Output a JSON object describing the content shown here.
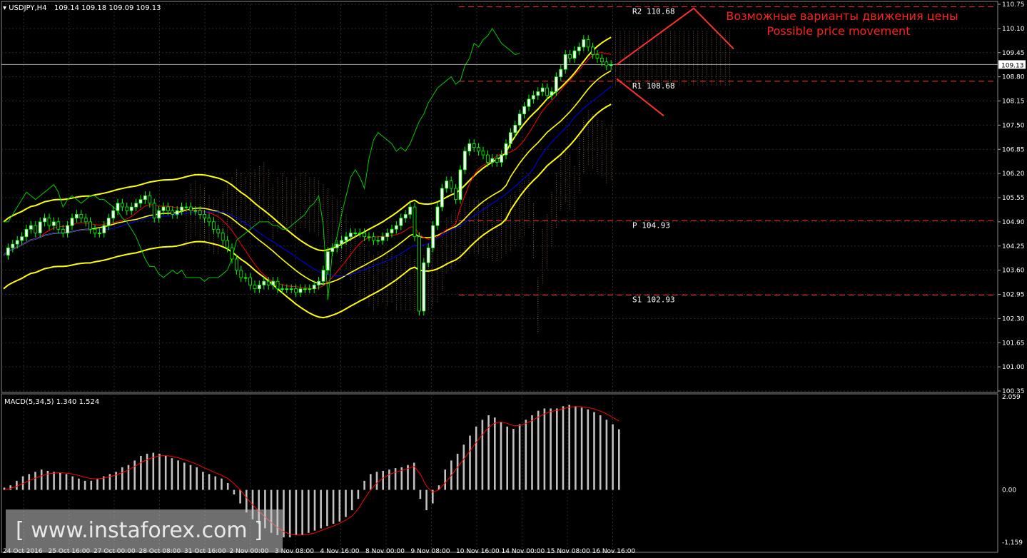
{
  "header": {
    "symbol": "USDJPY,H4",
    "ohlc": "109.14 109.18 109.09 109.13",
    "macd": "MACD(5,34,5) 1.340 1.524"
  },
  "annotation": {
    "line1": "Возможные варианты движения цены",
    "line2": "Possible price movement"
  },
  "watermark": "[ www.instaforex.com ]",
  "colors": {
    "candle_up": "#ffffff",
    "candle_down": "#000000",
    "wick": "#00ff00",
    "bollinger": "#ffff00",
    "ma_red": "#ff0000",
    "ma_blue": "#0000ff",
    "chikou": "#00cc00",
    "cloud": "#e0a080",
    "levels": "#ff3030",
    "macd_bars": "#c0c0c0",
    "macd_signal": "#ff0000",
    "grid": "#2a2a2a"
  },
  "chart_data": [
    {
      "type": "candlestick",
      "ylim": [
        100.35,
        110.75
      ],
      "y_ticks": [
        "110.75",
        "110.10",
        "109.45",
        "108.80",
        "108.15",
        "107.50",
        "106.85",
        "106.20",
        "105.55",
        "104.90",
        "104.25",
        "103.60",
        "102.95",
        "102.30",
        "101.65",
        "101.00",
        "100.35"
      ],
      "current_price": "109.13",
      "x_labels": [
        "24 Oct 2016",
        "25 Oct 16:00",
        "27 Oct 00:00",
        "28 Oct 08:00",
        "31 Oct 16:00",
        "2 Nov 00:00",
        "3 Nov 08:00",
        "4 Nov 16:00",
        "8 Nov 00:00",
        "9 Nov 08:00",
        "10 Nov 16:00",
        "14 Nov 00:00",
        "15 Nov 08:00",
        "16 Nov 16:00"
      ],
      "levels": [
        {
          "name": "R2",
          "label": "R2 110.68",
          "value": 110.68
        },
        {
          "name": "R1",
          "label": "R1 108.68",
          "value": 108.68
        },
        {
          "name": "P",
          "label": "P 104.93",
          "value": 104.93
        },
        {
          "name": "S1",
          "label": "S1 102.93",
          "value": 102.93
        }
      ],
      "close": [
        104.0,
        104.2,
        104.3,
        104.4,
        104.5,
        104.7,
        104.8,
        104.6,
        104.9,
        105.0,
        104.8,
        104.9,
        104.7,
        104.6,
        104.8,
        105.0,
        105.1,
        105.0,
        104.9,
        104.7,
        104.6,
        104.6,
        104.8,
        105.0,
        105.2,
        105.4,
        105.3,
        105.2,
        105.3,
        105.4,
        105.5,
        105.6,
        105.4,
        105.0,
        105.2,
        105.3,
        105.2,
        105.1,
        105.2,
        105.3,
        105.3,
        105.2,
        105.2,
        105.1,
        105.0,
        104.9,
        104.7,
        104.6,
        104.4,
        104.2,
        103.9,
        103.6,
        103.4,
        103.4,
        103.2,
        103.1,
        103.2,
        103.3,
        103.2,
        103.3,
        103.1,
        103.1,
        103.1,
        103.1,
        103.0,
        103.1,
        103.1,
        103.1,
        103.2,
        103.3,
        103.6,
        104.1,
        104.2,
        104.3,
        104.4,
        104.5,
        104.6,
        104.6,
        104.6,
        104.5,
        104.5,
        104.4,
        104.4,
        104.5,
        104.6,
        104.7,
        104.8,
        105.0,
        105.1,
        105.3,
        104.5,
        102.5,
        103.8,
        104.2,
        104.8,
        105.3,
        105.8,
        106.0,
        105.8,
        105.5,
        106.3,
        106.8,
        107.0,
        106.9,
        106.8,
        106.7,
        106.5,
        106.6,
        106.5,
        106.7,
        107.0,
        107.3,
        107.5,
        107.8,
        108.0,
        108.2,
        108.3,
        108.4,
        108.5,
        108.3,
        108.4,
        108.8,
        109.0,
        109.4,
        109.3,
        109.5,
        109.6,
        109.8,
        109.6,
        109.4,
        109.3,
        109.2,
        109.1,
        109.13
      ]
    },
    {
      "type": "bar",
      "title": "MACD(5,34,5) 1.340 1.524",
      "ylim": [
        -1.159,
        2.059
      ],
      "y_ticks": [
        "2.059",
        "0.00",
        "-1.159"
      ],
      "values": [
        0.05,
        0.1,
        0.2,
        0.3,
        0.35,
        0.4,
        0.45,
        0.42,
        0.4,
        0.38,
        0.35,
        0.3,
        0.25,
        0.2,
        0.2,
        0.25,
        0.3,
        0.35,
        0.4,
        0.5,
        0.55,
        0.65,
        0.75,
        0.8,
        0.82,
        0.8,
        0.75,
        0.7,
        0.65,
        0.6,
        0.55,
        0.5,
        0.4,
        0.35,
        0.3,
        0.25,
        0.15,
        -0.1,
        -0.3,
        -0.5,
        -0.65,
        -0.75,
        -0.85,
        -0.95,
        -1.0,
        -1.05,
        -1.05,
        -1.0,
        -1.0,
        -0.95,
        -0.9,
        -0.85,
        -0.8,
        -0.75,
        -0.7,
        -0.6,
        -0.45,
        -0.2,
        0.2,
        0.35,
        0.4,
        0.42,
        0.45,
        0.48,
        0.5,
        0.55,
        0.6,
        -0.2,
        -0.45,
        -0.3,
        0.1,
        0.45,
        0.65,
        0.8,
        1.0,
        1.2,
        1.4,
        1.55,
        1.65,
        1.6,
        1.5,
        1.4,
        1.35,
        1.45,
        1.55,
        1.65,
        1.75,
        1.8,
        1.8,
        1.8,
        1.85,
        1.88,
        1.85,
        1.82,
        1.78,
        1.72,
        1.65,
        1.55,
        1.45,
        1.34
      ],
      "signal": [
        0.0,
        0.03,
        0.08,
        0.14,
        0.2,
        0.26,
        0.31,
        0.35,
        0.37,
        0.38,
        0.37,
        0.35,
        0.32,
        0.28,
        0.25,
        0.24,
        0.26,
        0.29,
        0.33,
        0.38,
        0.44,
        0.52,
        0.6,
        0.67,
        0.72,
        0.75,
        0.76,
        0.74,
        0.71,
        0.67,
        0.62,
        0.57,
        0.5,
        0.44,
        0.38,
        0.32,
        0.25,
        0.14,
        0.0,
        -0.17,
        -0.33,
        -0.47,
        -0.6,
        -0.72,
        -0.83,
        -0.92,
        -0.98,
        -1.0,
        -1.0,
        -0.98,
        -0.95,
        -0.9,
        -0.85,
        -0.8,
        -0.74,
        -0.67,
        -0.58,
        -0.42,
        -0.2,
        0.0,
        0.15,
        0.26,
        0.34,
        0.39,
        0.43,
        0.47,
        0.52,
        0.35,
        0.08,
        -0.05,
        0.0,
        0.15,
        0.32,
        0.5,
        0.68,
        0.86,
        1.05,
        1.22,
        1.38,
        1.48,
        1.5,
        1.47,
        1.42,
        1.42,
        1.47,
        1.53,
        1.61,
        1.68,
        1.73,
        1.76,
        1.79,
        1.83,
        1.84,
        1.84,
        1.82,
        1.79,
        1.74,
        1.68,
        1.6,
        1.524
      ]
    }
  ]
}
